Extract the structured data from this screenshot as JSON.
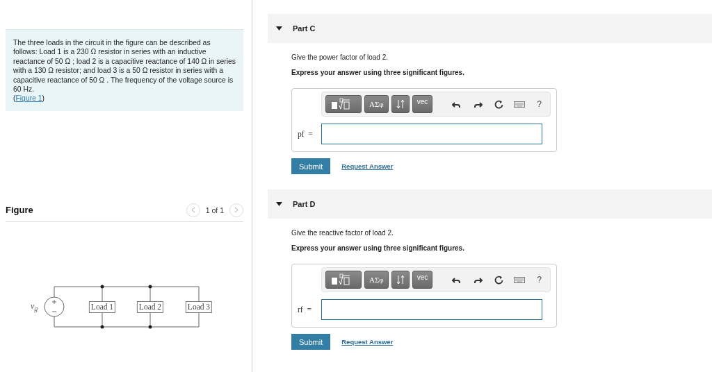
{
  "problem": {
    "text": "The three loads in the circuit in the figure can be described as follows: Load 1 is a 230 Ω resistor in series with an inductive reactance of 50 Ω ; load 2 is a capacitive reactance of 140 Ω in series with a 130 Ω resistor; and load 3 is a 50 Ω resistor in series with a capacitive reactance of 50 Ω . The frequency of the voltage source is 60 Hz.",
    "link_open": "(",
    "link": "Figure 1",
    "link_close": ")"
  },
  "figure": {
    "title": "Figure",
    "pager": "1 of 1",
    "source_label": "v$_{g}$",
    "loads": [
      "Load 1",
      "Load 2",
      "Load 3"
    ]
  },
  "parts": [
    {
      "title": "Part C",
      "expanded": true,
      "prompt": "Give the power factor of load 2.",
      "instruction": "Express your answer using three significant figures.",
      "toolbar": [
        "ΑΣφ",
        "vec",
        "?"
      ],
      "variable": "pf",
      "equals": "=",
      "submit": "Submit",
      "request": "Request Answer"
    },
    {
      "title": "Part D",
      "expanded": true,
      "prompt": "Give the reactive factor of load 2.",
      "instruction": "Express your answer using three significant figures.",
      "toolbar": [
        "ΑΣφ",
        "vec",
        "?"
      ],
      "variable": "rf",
      "equals": "=",
      "submit": "Submit",
      "request": "Request Answer"
    }
  ]
}
